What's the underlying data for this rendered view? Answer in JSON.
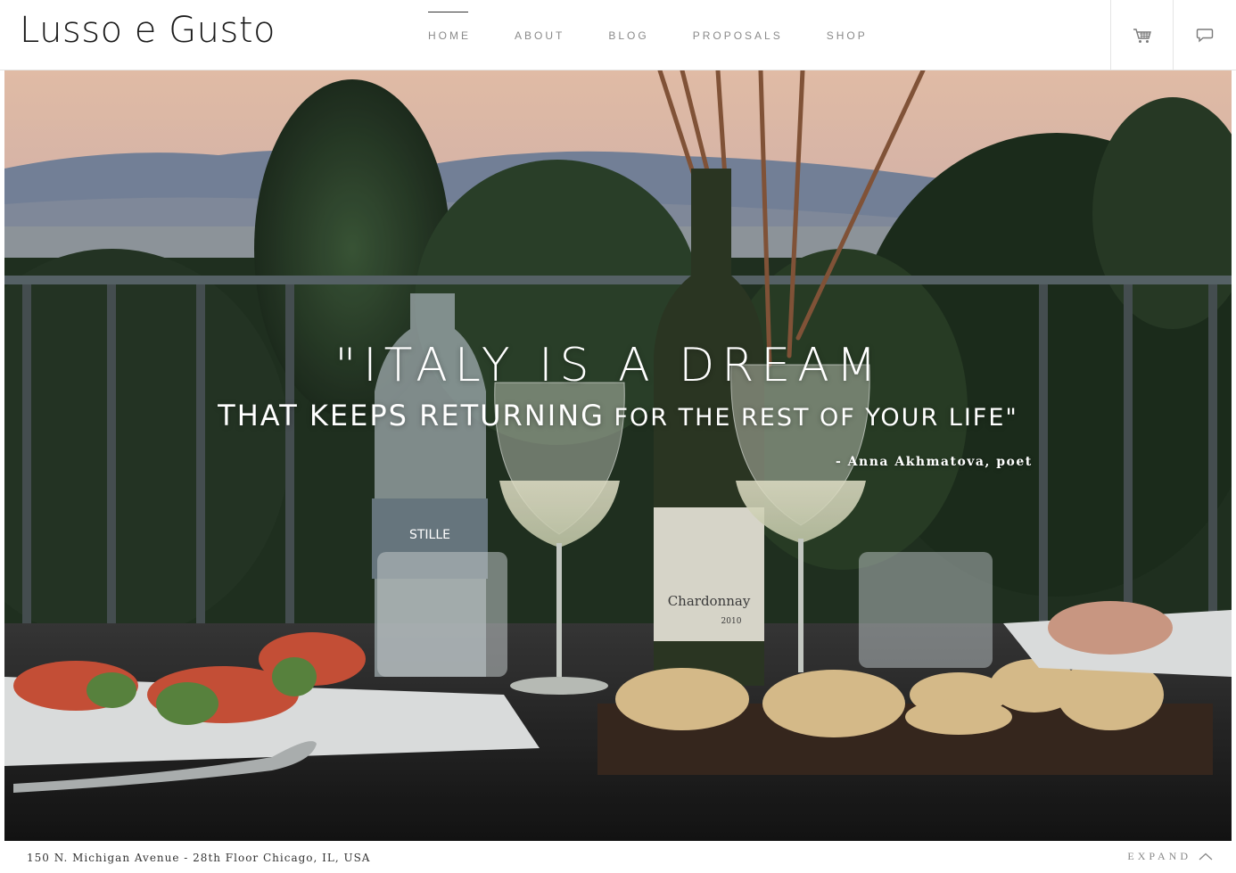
{
  "brand": {
    "logo": "Lusso e Gusto"
  },
  "nav": {
    "items": [
      {
        "label": "HOME",
        "active": true
      },
      {
        "label": "ABOUT"
      },
      {
        "label": "BLOG"
      },
      {
        "label": "PROPOSALS"
      },
      {
        "label": "SHOP"
      }
    ]
  },
  "header_actions": {
    "cart_icon": "cart-icon",
    "chat_icon": "chat-icon"
  },
  "hero": {
    "quote_line1": "\"ITALY IS A DREAM",
    "quote_line2_main": "THAT KEEPS RETURNING",
    "quote_line2_rest": " FOR THE REST OF YOUR LIFE\"",
    "attribution": "- Anna Akhmatova, poet",
    "bottle_label_water": "STILLE",
    "bottle_label_wine": "CHARDONNAY",
    "wine_year": "2010"
  },
  "footer": {
    "address": "150 N. Michigan Avenue - 28th Floor Chicago, IL, USA",
    "expand_label": "EXPAND"
  },
  "colors": {
    "nav_text": "#8a8a8a",
    "divider": "#e4e4e4",
    "logo": "#1a1a1a"
  }
}
